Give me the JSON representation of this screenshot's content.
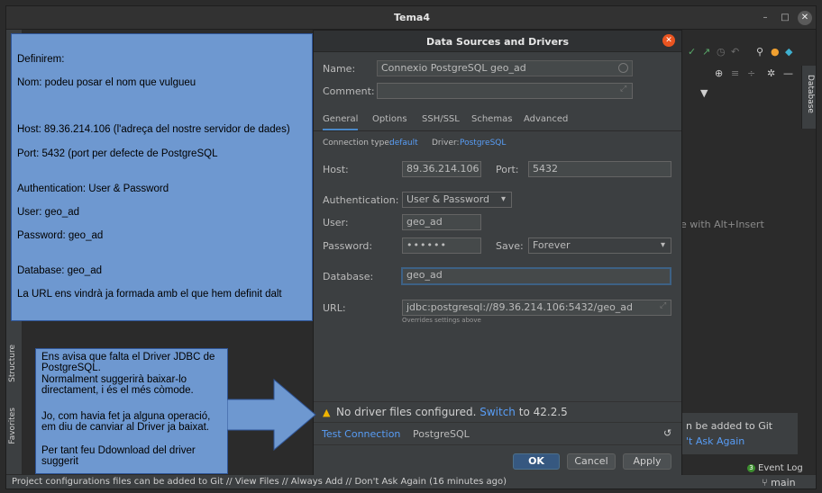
{
  "window": {
    "title": "Tema4",
    "minimize": "–",
    "maximize": "□",
    "close": "✕"
  },
  "background": {
    "hint": "e with Alt+Insert",
    "notification_line1": "n be added to Git",
    "notification_line2": "'t Ask Again",
    "event_log": "Event Log",
    "event_log_count": "3",
    "branch": "main",
    "status_text": "Project configurations files can be added to Git // View Files // Always Add // Don't Ask Again (16 minutes ago)",
    "database_tab": "Database",
    "structure_tab": "Structure",
    "favorites_tab": "Favorites"
  },
  "dialog": {
    "title": "Data Sources and Drivers",
    "name_label": "Name:",
    "name_value": "Connexio PostgreSQL geo_ad",
    "comment_label": "Comment:",
    "comment_value": "",
    "tabs": [
      "General",
      "Options",
      "SSH/SSL",
      "Schemas",
      "Advanced"
    ],
    "active_tab": "General",
    "conn_type_label": "Connection type:",
    "conn_type_value": "default",
    "driver_label": "Driver:",
    "driver_value": "PostgreSQL",
    "host_label": "Host:",
    "host_value": "89.36.214.106",
    "port_label": "Port:",
    "port_value": "5432",
    "auth_label": "Authentication:",
    "auth_value": "User & Password",
    "user_label": "User:",
    "user_value": "geo_ad",
    "password_label": "Password:",
    "password_value": "••••••",
    "save_label": "Save:",
    "save_value": "Forever",
    "database_label": "Database:",
    "database_value": "geo_ad",
    "url_label": "URL:",
    "url_value": "jdbc:postgresql://89.36.214.106:5432/geo_ad",
    "url_note": "Overrides settings above",
    "warning_text": "No driver files configured.",
    "warning_link": "Switch",
    "warning_suffix": "to 42.2.5",
    "test_connection": "Test Connection",
    "driver_name": "PostgreSQL",
    "ok": "OK",
    "cancel": "Cancel",
    "apply": "Apply"
  },
  "annotations": {
    "box1": [
      "Definirem:",
      "Nom: podeu posar el nom que vulgueu",
      "Host: 89.36.214.106 (l'adreça del nostre servidor de dades)",
      "Port: 5432 (port per defecte de PostgreSQL",
      "Authentication: User & Password",
      "User: geo_ad",
      "Password: geo_ad",
      "Database: geo_ad",
      "La URL ens vindrà ja formada amb el que hem definit dalt"
    ],
    "box2": [
      "Ens avisa que falta el Driver JDBC de PostgreSQL.",
      "Normalment suggerirà baixar-lo directament, i és el més còmode.",
      "Jo, com havia fet ja alguna operació, em diu de canviar al Driver ja baixat.",
      "Per tant feu Ddownload del driver suggerit"
    ]
  },
  "colors": {
    "annotation_fill": "#6e98d0",
    "accent": "#589df6",
    "primary_button": "#365880",
    "dialog_close": "#e95420",
    "warning": "#f0b400"
  }
}
